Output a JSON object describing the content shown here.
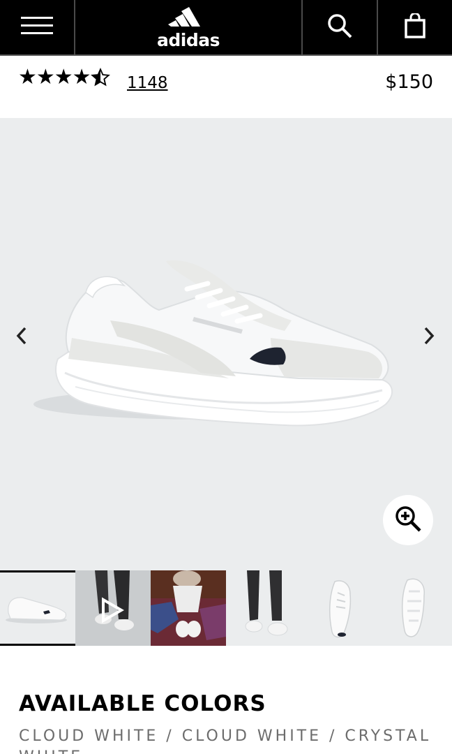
{
  "header": {
    "menu_icon": "hamburger-menu-icon",
    "brand": "adidas",
    "search_icon": "search-icon",
    "bag_icon": "shopping-bag-icon"
  },
  "product": {
    "rating_stars": "★★★★",
    "rating_value": 4.5,
    "review_count": "1148",
    "price": "$150"
  },
  "gallery": {
    "prev_icon": "chevron-left-icon",
    "next_icon": "chevron-right-icon",
    "zoom_icon": "zoom-in-icon",
    "thumbnails": [
      {
        "name": "side-view",
        "selected": true
      },
      {
        "name": "video",
        "selected": false
      },
      {
        "name": "lifestyle-top-view",
        "selected": false
      },
      {
        "name": "on-foot-view",
        "selected": false
      },
      {
        "name": "top-view",
        "selected": false
      },
      {
        "name": "sole-view",
        "selected": false
      }
    ]
  },
  "colors": {
    "title": "AVAILABLE COLORS",
    "value": "CLOUD WHITE / CLOUD WHITE / CRYSTAL WHITE"
  },
  "theme": {
    "header_bg": "#000000",
    "hero_bg": "#ebedee",
    "text": "#000000",
    "muted": "#6c6c6c"
  }
}
